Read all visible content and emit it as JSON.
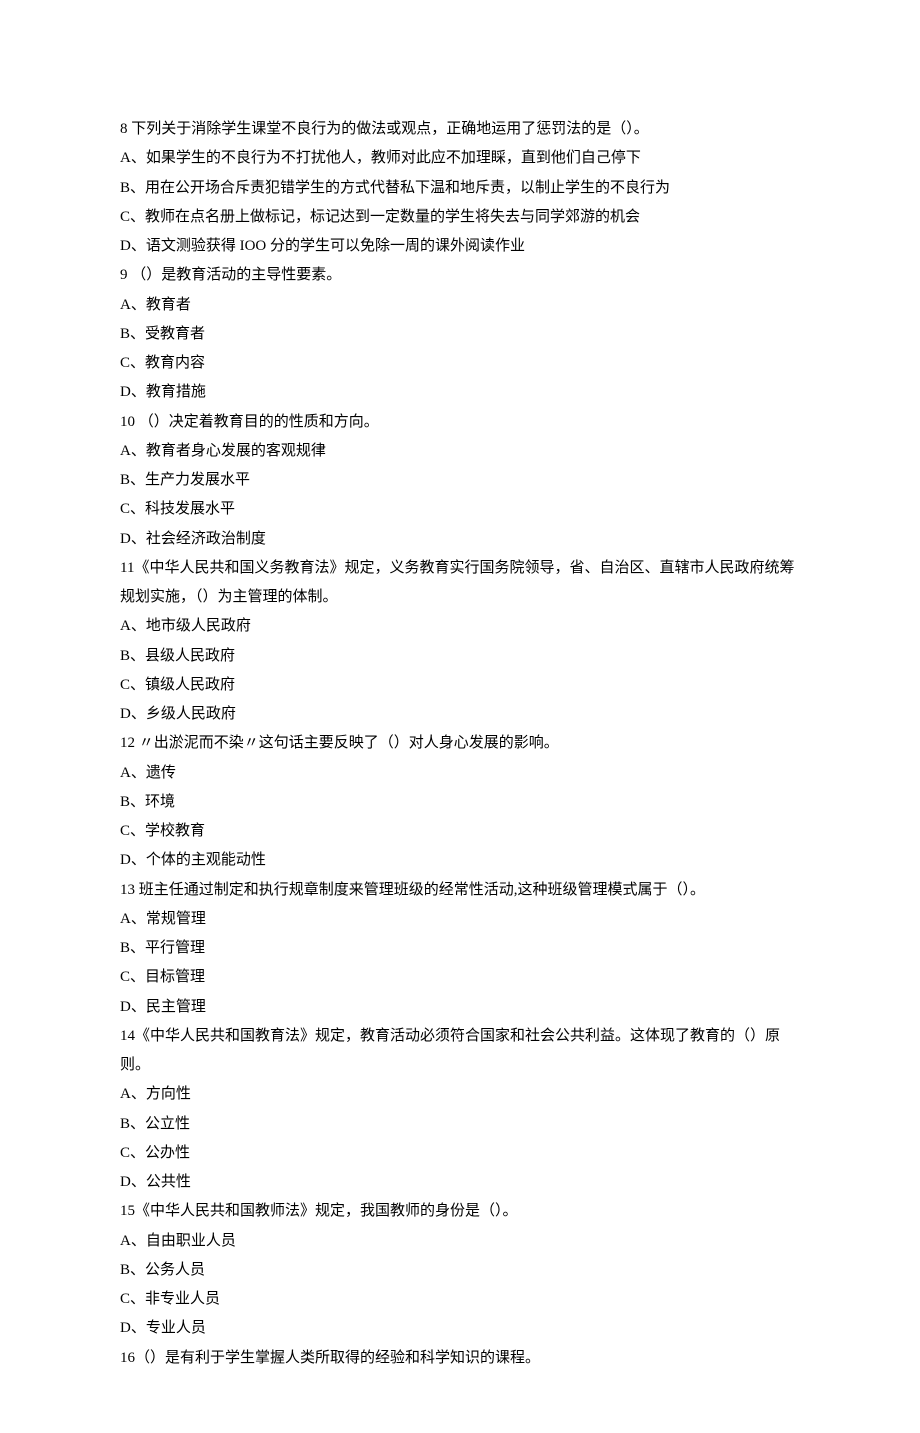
{
  "lines": [
    "8 下列关于消除学生课堂不良行为的做法或观点，正确地运用了惩罚法的是（）。",
    "A、如果学生的不良行为不打扰他人，教师对此应不加理睬，直到他们自己停下",
    "B、用在公开场合斥责犯错学生的方式代替私下温和地斥责，以制止学生的不良行为",
    "C、教师在点名册上做标记，标记达到一定数量的学生将失去与同学郊游的机会",
    "D、语文测验获得 IOO 分的学生可以免除一周的课外阅读作业",
    "9   （）是教育活动的主导性要素。",
    "A、教育者",
    "B、受教育者",
    "C、教育内容",
    "D、教育措施",
    "10   （）决定着教育目的的性质和方向。",
    "A、教育者身心发展的客观规律",
    "B、生产力发展水平",
    "C、科技发展水平",
    "D、社会经济政治制度",
    "11《中华人民共和国义务教育法》规定，义务教育实行国务院领导，省、自治区、直辖市人民政府统筹规划实施，（）为主管理的体制。",
    "A、地市级人民政府",
    "B、县级人民政府",
    "C、镇级人民政府",
    "D、乡级人民政府",
    "12 〃出淤泥而不染〃这句话主要反映了（）对人身心发展的影响。",
    "A、遗传",
    "B、环境",
    "C、学校教育",
    "D、个体的主观能动性",
    "13 班主任通过制定和执行规章制度来管理班级的经常性活动,这种班级管理模式属于（）。",
    "A、常规管理",
    "B、平行管理",
    "C、目标管理",
    "D、民主管理",
    "14《中华人民共和国教育法》规定，教育活动必须符合国家和社会公共利益。这体现了教育的（）原则。",
    "A、方向性",
    "B、公立性",
    "C、公办性",
    "D、公共性",
    "15《中华人民共和国教师法》规定，我国教师的身份是（）。",
    "A、自由职业人员",
    "B、公务人员",
    "C、非专业人员",
    "D、专业人员",
    "16（）是有利于学生掌握人类所取得的经验和科学知识的课程。"
  ]
}
